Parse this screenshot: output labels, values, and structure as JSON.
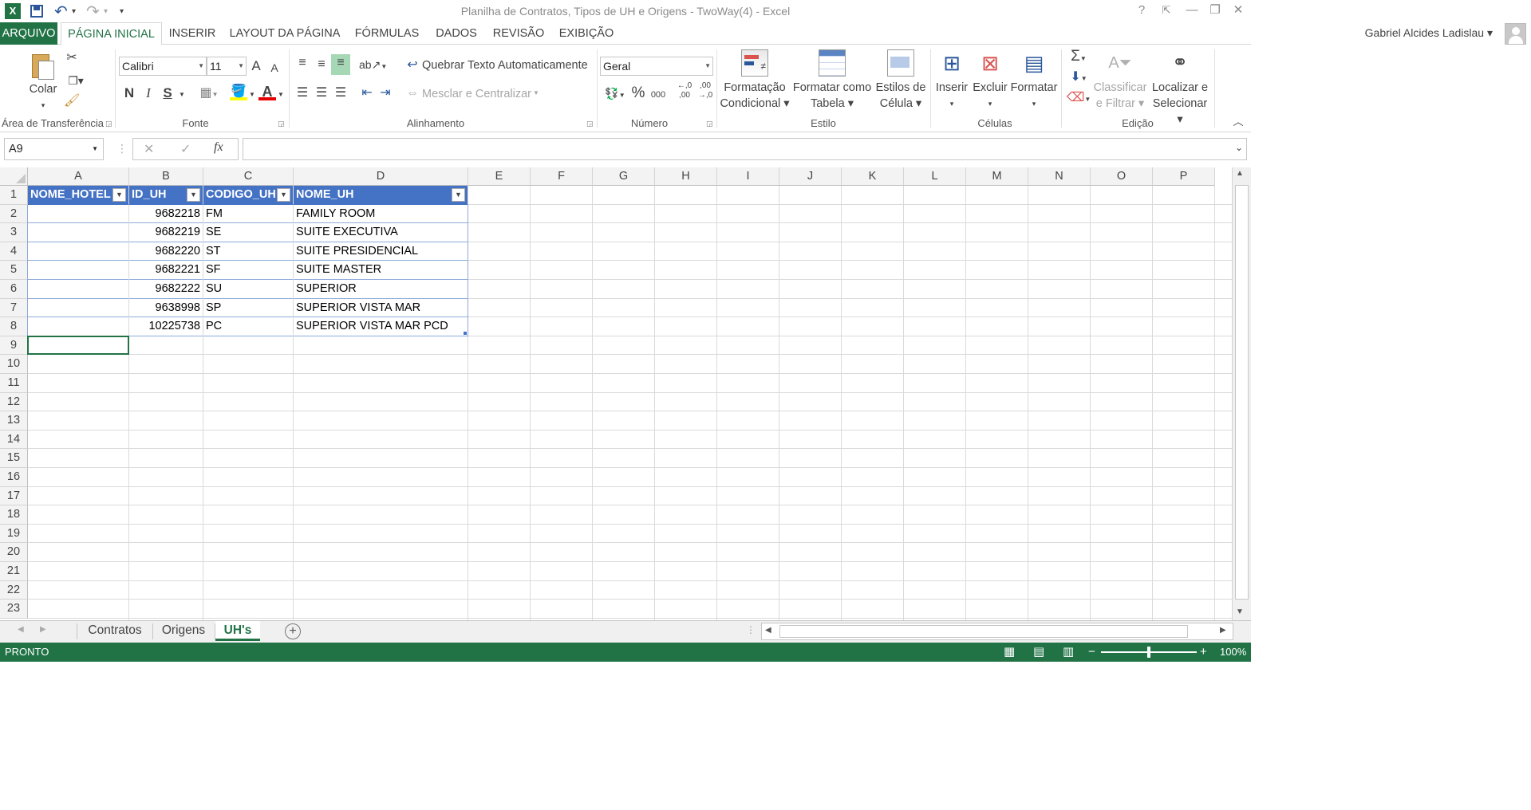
{
  "window": {
    "title": "Planilha de Contratos, Tipos de UH e Origens - TwoWay(4) - Excel",
    "help": "?",
    "minimize": "—",
    "restore": "❐",
    "close": "✕"
  },
  "qat": {
    "excel": "X",
    "save": "💾",
    "undo": "↶",
    "redo": "↷",
    "more": "▾"
  },
  "tabs": [
    "ARQUIVO",
    "PÁGINA INICIAL",
    "INSERIR",
    "LAYOUT DA PÁGINA",
    "FÓRMULAS",
    "DADOS",
    "REVISÃO",
    "EXIBIÇÃO"
  ],
  "user": {
    "name": "Gabriel Alcides Ladislau ▾"
  },
  "ribbon": {
    "clipboard": {
      "label": "Área de Transferência",
      "paste": "Colar"
    },
    "font": {
      "label": "Fonte",
      "name": "Calibri",
      "size": "11",
      "bold": "N",
      "italic": "I",
      "underline": "S",
      "grow": "A",
      "shrink": "A"
    },
    "alignment": {
      "label": "Alinhamento",
      "wrap": "Quebrar Texto Automaticamente",
      "merge": "Mesclar e Centralizar"
    },
    "number": {
      "label": "Número",
      "format": "Geral",
      "percent": "%",
      "thousands": "000",
      "inc": "←,0 ,00",
      "dec": ",00 →,0"
    },
    "styles": {
      "label": "Estilo",
      "cond1": "Formatação",
      "cond2": "Condicional ▾",
      "table1": "Formatar como",
      "table2": "Tabela ▾",
      "cell1": "Estilos de",
      "cell2": "Célula ▾"
    },
    "cells": {
      "label": "Células",
      "insert": "Inserir",
      "delete": "Excluir",
      "format": "Formatar"
    },
    "editing": {
      "label": "Edição",
      "sort1": "Classificar",
      "sort2": "e Filtrar ▾",
      "find1": "Localizar e",
      "find2": "Selecionar ▾",
      "sigma": "Σ"
    }
  },
  "formula_bar": {
    "namebox": "A9",
    "cancel": "✕",
    "enter": "✓",
    "fx": "fx",
    "value": ""
  },
  "columns": [
    "A",
    "B",
    "C",
    "D",
    "E",
    "F",
    "G",
    "H",
    "I",
    "J",
    "K",
    "L",
    "M",
    "N",
    "O",
    "P"
  ],
  "rows": [
    "1",
    "2",
    "3",
    "4",
    "5",
    "6",
    "7",
    "8",
    "9",
    "10",
    "11",
    "12",
    "13",
    "14",
    "15",
    "16",
    "17",
    "18",
    "19",
    "20",
    "21",
    "22",
    "23"
  ],
  "table": {
    "headers": [
      "NOME_HOTEL",
      "ID_UH",
      "CODIGO_UH",
      "NOME_UH"
    ],
    "rows": [
      [
        "",
        "9682218",
        "FM",
        "FAMILY ROOM"
      ],
      [
        "",
        "9682219",
        "SE",
        "SUITE EXECUTIVA"
      ],
      [
        "",
        "9682220",
        "ST",
        "SUITE PRESIDENCIAL"
      ],
      [
        "",
        "9682221",
        "SF",
        "SUITE MASTER"
      ],
      [
        "",
        "9682222",
        "SU",
        "SUPERIOR"
      ],
      [
        "",
        "9638998",
        "SP",
        "SUPERIOR VISTA MAR"
      ],
      [
        "",
        "10225738",
        "PC",
        "SUPERIOR VISTA MAR PCD"
      ]
    ]
  },
  "sheets": [
    "Contratos",
    "Origens",
    "UH's"
  ],
  "status": {
    "left": "PRONTO",
    "zoom": "100%"
  },
  "colors": {
    "accent": "#217346",
    "table_header": "#4472c4"
  }
}
